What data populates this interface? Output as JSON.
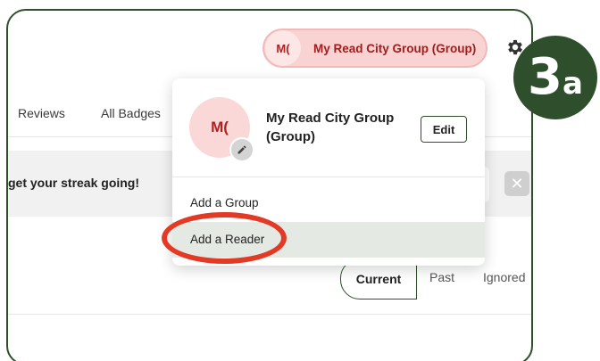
{
  "header": {
    "account_initials": "M(",
    "account_name": "My Read City Group (Group)",
    "settings_icon": "gear-icon"
  },
  "nav": {
    "items": [
      {
        "label": "Reviews"
      },
      {
        "label": "All Badges"
      }
    ]
  },
  "banner": {
    "text": "get your streak going!",
    "close_glyph": "✕"
  },
  "filters": {
    "current": "Current",
    "past": "Past",
    "ignored": "Ignored"
  },
  "dropdown": {
    "initials": "M(",
    "name": "My Read City Group (Group)",
    "edit_label": "Edit",
    "add_group": "Add a Group",
    "add_reader": "Add a Reader",
    "avatar_edit_icon": "pencil-icon"
  },
  "step": {
    "number": "3",
    "letter": "a"
  },
  "colors": {
    "brand_green": "#2f4f2c",
    "pill_bg": "#f9d2d2",
    "pill_text": "#a11d1d",
    "highlight_red": "#e23a24"
  }
}
